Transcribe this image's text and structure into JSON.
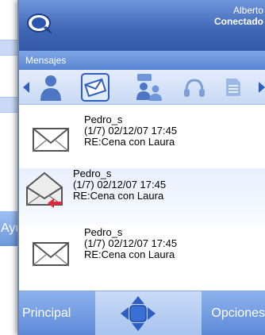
{
  "background_window": {
    "button_label": "Ayu"
  },
  "header": {
    "user_name": "Alberto",
    "status": "Conectado"
  },
  "section": {
    "title": "Mensajes"
  },
  "toolbar": {
    "icons": [
      "user-icon",
      "message-icon",
      "chat-icon",
      "headset-icon",
      "document-icon"
    ],
    "selected": "message-icon"
  },
  "messages": [
    {
      "sender": "Pedro_s",
      "meta": "(1/7) 02/12/07 17:45",
      "subject": "RE:Cena con Laura",
      "state": "unread"
    },
    {
      "sender": "Pedro_s",
      "meta": "(1/7) 02/12/07 17:45",
      "subject": "RE:Cena con Laura",
      "state": "replied"
    },
    {
      "sender": "Pedro_s",
      "meta": "(1/7) 02/12/07 17:45",
      "subject": "RE:Cena con Laura",
      "state": "unread"
    }
  ],
  "softkeys": {
    "left": "Principal",
    "right": "Opciones"
  },
  "colors": {
    "header_blue": "#3f66b6",
    "accent_red": "#e0283a"
  }
}
